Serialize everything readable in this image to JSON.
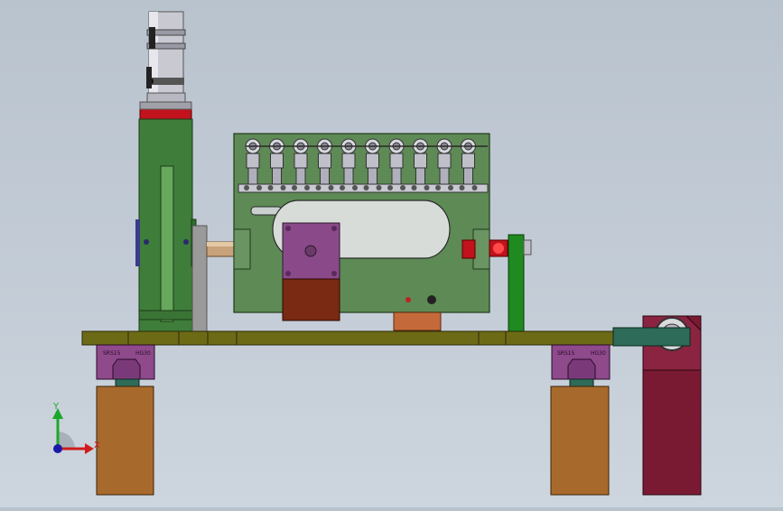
{
  "viewport": {
    "background_top": "#b9c3ce",
    "background_bottom": "#cdd5de"
  },
  "colors": {
    "upright_green": "#3f7d3a",
    "panel_green": "#5e8a55",
    "base_plate": "#6d6a16",
    "carriage_purple": "#8e4a8a",
    "support_orange": "#a86a2c",
    "bearing_block": "#7a1a32",
    "motor_purple": "#8a4a8a",
    "motor_base": "#7a2a12",
    "red_cap": "#c2121d",
    "cylinder_silver": "#c9c9d2",
    "guide_green": "#1f8a1f",
    "bar_teal": "#2e6b58"
  },
  "carriages": {
    "left": {
      "label_a": "SRS15",
      "label_b": "HG30"
    },
    "right": {
      "label_a": "SRS15",
      "label_b": "HG30"
    }
  },
  "nozzles": {
    "count": 10
  },
  "triad": {
    "y_label": "Y",
    "x_label": "X",
    "icon": "coordinate-triad-icon"
  }
}
